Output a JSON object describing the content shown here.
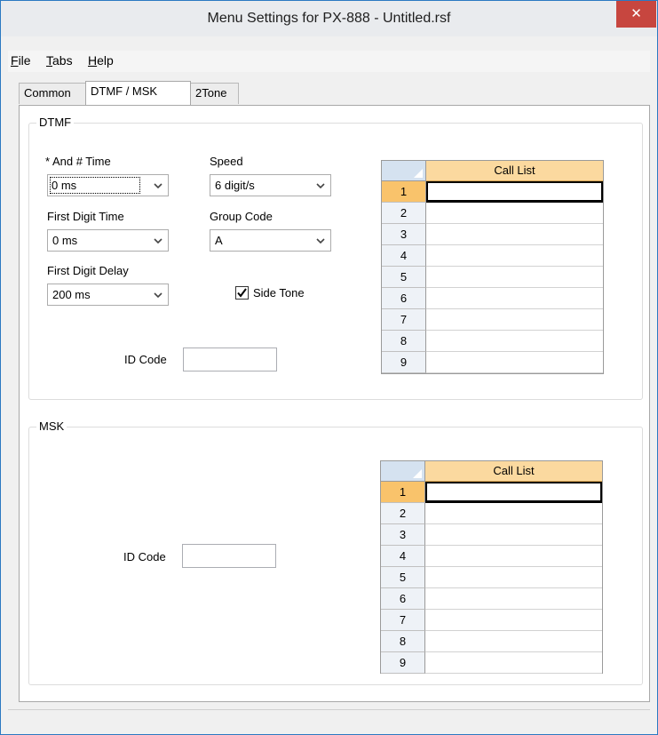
{
  "window": {
    "title": "Menu Settings for PX-888 - Untitled.rsf",
    "close_glyph": "✕"
  },
  "menu": [
    {
      "label": "File",
      "mnemonic": "F",
      "rest": "ile"
    },
    {
      "label": "Tabs",
      "mnemonic": "T",
      "rest": "abs"
    },
    {
      "label": "Help",
      "mnemonic": "H",
      "rest": "elp"
    }
  ],
  "tabs": [
    "Common",
    "DTMF / MSK",
    "2Tone"
  ],
  "active_tab": "DTMF / MSK",
  "dtmf": {
    "group_label": "DTMF",
    "star_hash_time": {
      "label": "* And # Time",
      "value": "0 ms"
    },
    "speed": {
      "label": "Speed",
      "value": "6 digit/s"
    },
    "first_digit_time": {
      "label": "First Digit Time",
      "value": "0 ms"
    },
    "group_code": {
      "label": "Group Code",
      "value": "A"
    },
    "first_digit_delay": {
      "label": "First Digit Delay",
      "value": "200 ms"
    },
    "side_tone": {
      "label": "Side Tone",
      "checked": true
    },
    "id_code": {
      "label": "ID Code",
      "value": ""
    },
    "call_list": {
      "header": "Call List",
      "selected_row": 1,
      "rows": [
        "1",
        "2",
        "3",
        "4",
        "5",
        "6",
        "7",
        "8",
        "9"
      ],
      "values": [
        "",
        "",
        "",
        "",
        "",
        "",
        "",
        "",
        ""
      ]
    }
  },
  "msk": {
    "group_label": "MSK",
    "id_code": {
      "label": "ID Code",
      "value": ""
    },
    "call_list": {
      "header": "Call List",
      "selected_row": 1,
      "rows": [
        "1",
        "2",
        "3",
        "4",
        "5",
        "6",
        "7",
        "8",
        "9"
      ],
      "values": [
        "",
        "",
        "",
        "",
        "",
        "",
        "",
        "",
        ""
      ]
    }
  },
  "colors": {
    "grid_header": "#fbd99f",
    "grid_selected_rowhead": "#f9c36b",
    "close_button": "#c7463f"
  },
  "icons": [
    "close-icon",
    "chevron-down-icon",
    "checkmark-icon",
    "grid-corner-icon"
  ]
}
